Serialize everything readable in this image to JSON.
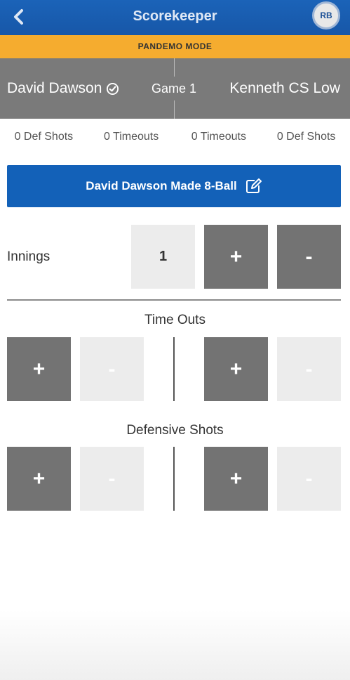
{
  "header": {
    "title": "Scorekeeper",
    "back_icon": "chevron-left-icon",
    "avatar_initials": "RB"
  },
  "mode_banner": "PANDEMO MODE",
  "match": {
    "player1": "David Dawson",
    "player1_icon": "check-circle-icon",
    "game_label": "Game 1",
    "player2": "Kenneth CS Low"
  },
  "stats": [
    "0 Def Shots",
    "0 Timeouts",
    "0 Timeouts",
    "0 Def Shots"
  ],
  "made_button": {
    "label": "David Dawson Made 8-Ball",
    "icon": "edit-icon"
  },
  "innings": {
    "label": "Innings",
    "value": "1",
    "plus": "+",
    "minus": "-"
  },
  "timeouts": {
    "title": "Time Outs",
    "p1_plus": "+",
    "p1_minus": "-",
    "p2_plus": "+",
    "p2_minus": "-"
  },
  "defensive": {
    "title": "Defensive Shots",
    "p1_plus": "+",
    "p1_minus": "-",
    "p2_plus": "+",
    "p2_minus": "-"
  },
  "colors": {
    "header": "#1a5fb4",
    "banner": "#f5ac2f",
    "players_bar": "#7a7a7a",
    "primary_button": "#1361b8",
    "dark_box": "#737373",
    "light_box": "#ececec"
  }
}
